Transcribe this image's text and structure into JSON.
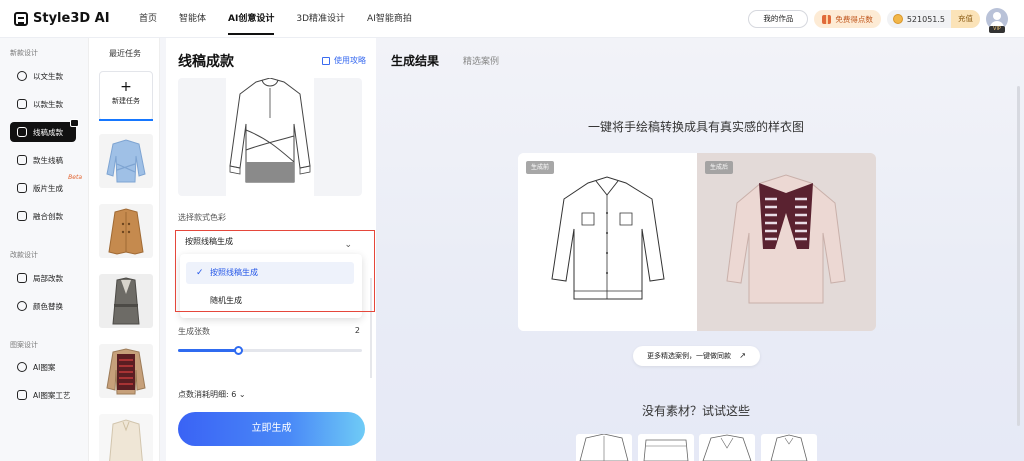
{
  "brand": {
    "name": "Style3D AI"
  },
  "nav": [
    {
      "label": "首页",
      "active": false
    },
    {
      "label": "智能体",
      "active": false
    },
    {
      "label": "AI创意设计",
      "active": true
    },
    {
      "label": "3D精准设计",
      "active": false
    },
    {
      "label": "AI智能商拍",
      "active": false
    }
  ],
  "header": {
    "my_works": "我的作品",
    "free_points": "免费得点数",
    "balance": "521051.5",
    "recharge": "充值",
    "vip": "VIP"
  },
  "sidebar": {
    "groups": [
      {
        "title": "新款设计",
        "items": [
          "以文生款",
          "以款生款",
          "线稿成款",
          "款生线稿",
          "版片生成",
          "融合创款"
        ]
      },
      {
        "title": "改款设计",
        "items": [
          "局部改款",
          "颜色替换"
        ]
      },
      {
        "title": "图案设计",
        "items": [
          "AI图案",
          "AI图案工艺"
        ]
      }
    ],
    "active_item": "线稿成款",
    "beta_label": "Beta"
  },
  "recent": {
    "title": "最近任务",
    "new_task": "新建任务"
  },
  "panel": {
    "title": "线稿成款",
    "guide": "使用攻略",
    "color_label": "选择款式色彩",
    "color_selected": "按照线稿生成",
    "options": [
      "按照线稿生成",
      "随机生成"
    ],
    "count_label": "生成张数",
    "count_value": "2",
    "count_fraction": 0.33,
    "cost_label": "点数消耗明细: 6",
    "generate_button": "立即生成"
  },
  "main": {
    "tabs": [
      "生成结果",
      "精选案例"
    ],
    "headline": "一键将手绘稿转换成具有真实感的样衣图",
    "tag_before": "生成前",
    "tag_after": "生成后",
    "more_link": "更多精选案例，一键做同款",
    "no_material": "没有素材？试试这些"
  }
}
